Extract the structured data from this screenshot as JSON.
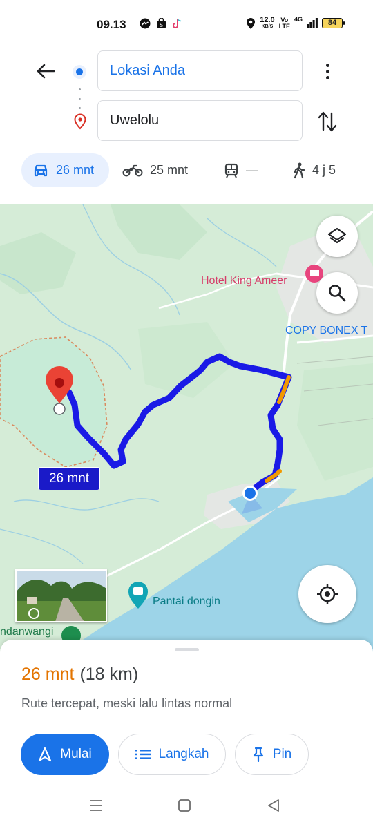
{
  "status_bar": {
    "time": "09.13",
    "net_speed": "12.0",
    "net_unit": "KB/S",
    "volte": "Vo",
    "lte": "LTE",
    "network": "4G",
    "battery": "84"
  },
  "directions": {
    "origin_value": "Lokasi Anda",
    "destination_value": "Uwelolu",
    "modes": [
      {
        "label": "26 mnt",
        "icon": "car-icon",
        "active": true
      },
      {
        "label": "25 mnt",
        "icon": "motorcycle-icon"
      },
      {
        "label": "—",
        "icon": "transit-icon"
      },
      {
        "label": "4 j 5",
        "icon": "walk-icon"
      }
    ]
  },
  "map": {
    "labels": {
      "hotel": "Hotel King Ameer",
      "copy": "COPY BONEX T",
      "beach": "Pantai dongin",
      "mangrove": "ndanwangi"
    },
    "route_badge": "26 mnt",
    "colors": {
      "route": "#1a1ae6",
      "traffic": "#f29900",
      "water": "#9dd4e8",
      "land": "#d5ecd7"
    }
  },
  "sheet": {
    "duration": "26 mnt",
    "distance": "(18 km)",
    "description": "Rute tercepat, meski lalu lintas normal",
    "start_label": "Mulai",
    "steps_label": "Langkah",
    "pin_label": "Pin"
  }
}
